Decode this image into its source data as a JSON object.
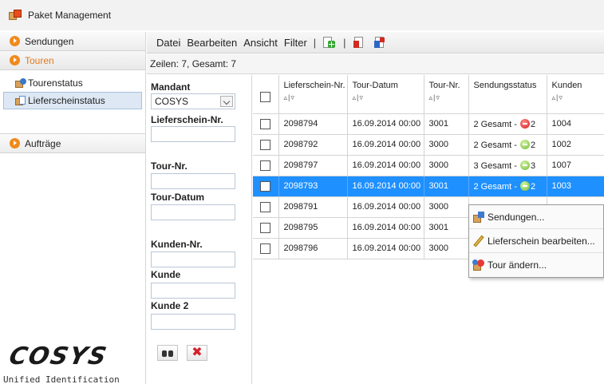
{
  "window": {
    "title": "Paket Management"
  },
  "sidebar": {
    "sections": [
      {
        "label": "Sendungen"
      },
      {
        "label": "Touren"
      },
      {
        "label": "Aufträge"
      }
    ],
    "items": [
      {
        "label": "Tourenstatus"
      },
      {
        "label": "Lieferscheinstatus"
      }
    ],
    "logo": {
      "text": "COSYS",
      "subtitle": "Unified Identification"
    }
  },
  "menubar": {
    "datei": "Datei",
    "bearbeiten": "Bearbeiten",
    "ansicht": "Ansicht",
    "filter": "Filter",
    "separator": "|"
  },
  "rows_info": "Zeilen: 7, Gesamt: 7",
  "filter": {
    "mandant_label": "Mandant",
    "mandant_value": "COSYS",
    "lieferschein_label": "Lieferschein-Nr.",
    "tour_nr_label": "Tour-Nr.",
    "tour_datum_label": "Tour-Datum",
    "kunden_nr_label": "Kunden-Nr.",
    "kunde_label": "Kunde",
    "kunde2_label": "Kunde 2"
  },
  "table": {
    "sorter": "▵|▿",
    "headers": {
      "lieferschein": "Lieferschein-Nr.",
      "tour_datum": "Tour-Datum",
      "tour_nr": "Tour-Nr.",
      "status": "Sendungsstatus",
      "kunden": "Kunden"
    },
    "rows": [
      {
        "lieferschein": "2098794",
        "datum": "16.09.2014 00:00",
        "tour": "3001",
        "status_prefix": "2 Gesamt -",
        "status_count": "2",
        "kunden": "1004"
      },
      {
        "lieferschein": "2098792",
        "datum": "16.09.2014 00:00",
        "tour": "3000",
        "status_prefix": "2 Gesamt -",
        "status_count": "2",
        "kunden": "1002"
      },
      {
        "lieferschein": "2098797",
        "datum": "16.09.2014 00:00",
        "tour": "3000",
        "status_prefix": "3 Gesamt -",
        "status_count": "3",
        "kunden": "1007"
      },
      {
        "lieferschein": "2098793",
        "datum": "16.09.2014 00:00",
        "tour": "3001",
        "status_prefix": "2 Gesamt -",
        "status_count": "2",
        "kunden": "1003"
      },
      {
        "lieferschein": "2098791",
        "datum": "16.09.2014 00:00",
        "tour": "3000",
        "status_prefix": "",
        "status_count": "",
        "kunden": ""
      },
      {
        "lieferschein": "2098795",
        "datum": "16.09.2014 00:00",
        "tour": "3001",
        "status_prefix": "",
        "status_count": "",
        "kunden": ""
      },
      {
        "lieferschein": "2098796",
        "datum": "16.09.2014 00:00",
        "tour": "3000",
        "status_prefix": "",
        "status_count": "",
        "kunden": ""
      }
    ]
  },
  "context_menu": {
    "sendungen": "Sendungen...",
    "lieferschein_bearbeiten": "Lieferschein bearbeiten...",
    "tour_aendern": "Tour ändern..."
  },
  "colors": {
    "accent": "#f08a1c",
    "selection": "#1e90ff",
    "status_red": "#d3202a",
    "status_green": "#6fb93a"
  }
}
